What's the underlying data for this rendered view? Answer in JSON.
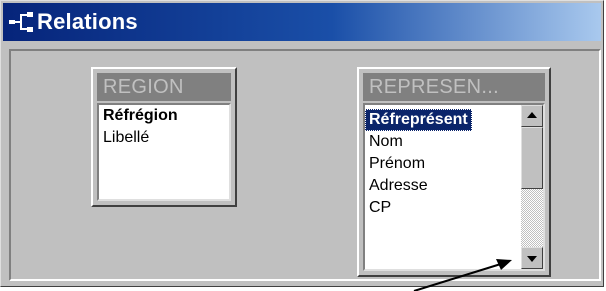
{
  "window": {
    "title": "Relations",
    "icon": "relationships-icon"
  },
  "tables": [
    {
      "name": "REGION",
      "fields": [
        {
          "label": "Réfrégion",
          "primary_key": true
        },
        {
          "label": "Libellé",
          "primary_key": false
        }
      ]
    },
    {
      "name": "REPRESEN...",
      "fields": [
        {
          "label": "Réfreprésent",
          "primary_key": true,
          "selected": true
        },
        {
          "label": "Nom",
          "primary_key": false
        },
        {
          "label": "Prénom",
          "primary_key": false
        },
        {
          "label": "Adresse",
          "primary_key": false
        },
        {
          "label": "CP",
          "primary_key": false
        }
      ],
      "scrollbar": {
        "visible": true
      }
    }
  ],
  "annotation": {
    "type": "arrow",
    "points_to": "scroll-down-button",
    "color": "#000000"
  }
}
